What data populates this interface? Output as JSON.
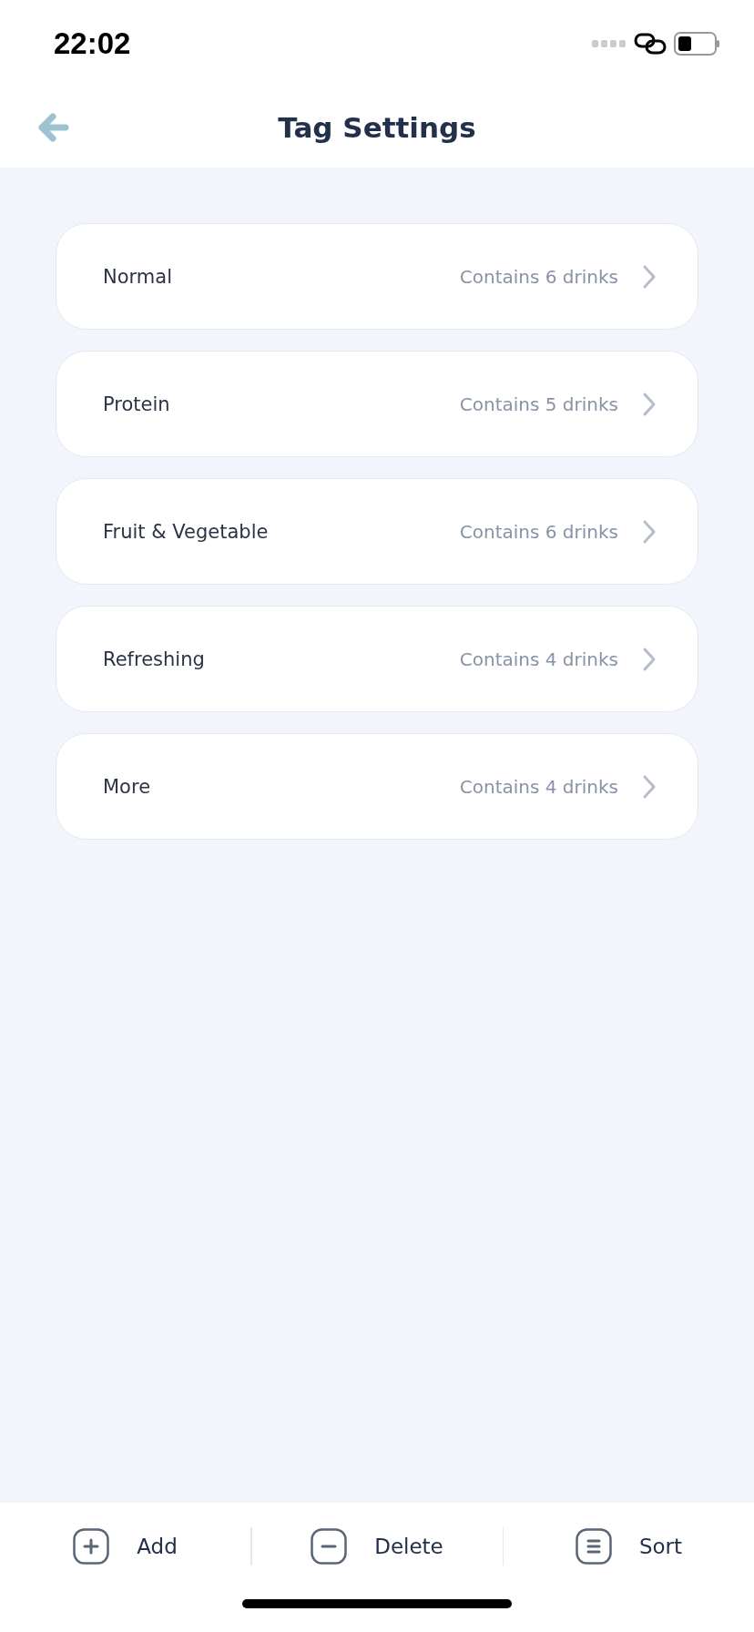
{
  "status_bar": {
    "time": "22:02"
  },
  "header": {
    "title": "Tag Settings"
  },
  "tags": [
    {
      "name": "Normal",
      "count": "Contains 6 drinks"
    },
    {
      "name": "Protein",
      "count": "Contains 5 drinks"
    },
    {
      "name": "Fruit & Vegetable",
      "count": "Contains 6 drinks"
    },
    {
      "name": "Refreshing",
      "count": "Contains 4 drinks"
    },
    {
      "name": "More",
      "count": "Contains 4 drinks"
    }
  ],
  "actions": [
    {
      "kind": "add",
      "label": "Add"
    },
    {
      "kind": "delete",
      "label": "Delete"
    },
    {
      "kind": "sort",
      "label": "Sort"
    }
  ]
}
